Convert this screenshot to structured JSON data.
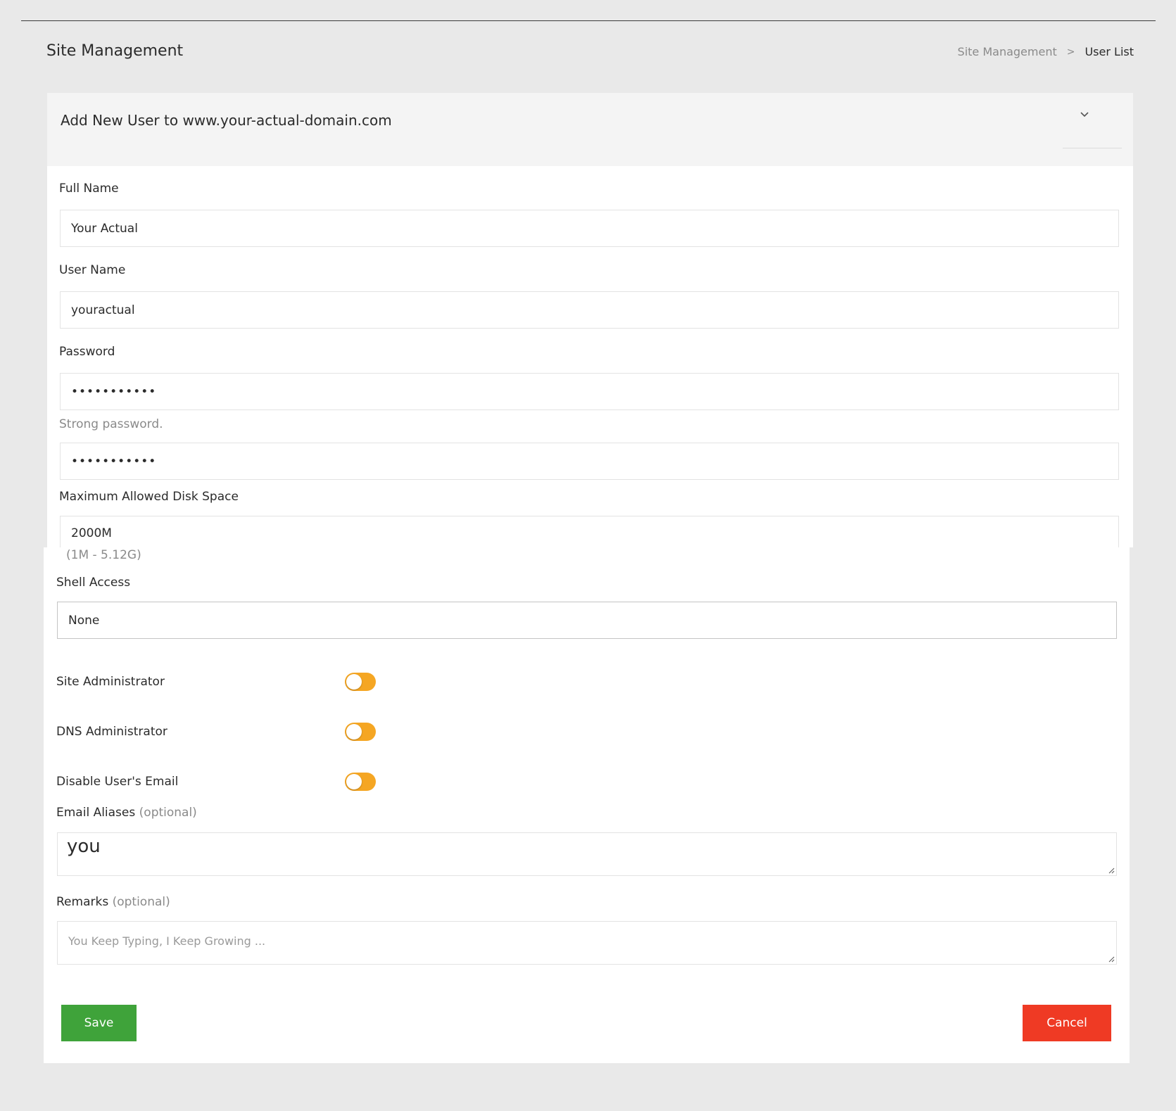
{
  "header": {
    "page_title": "Site Management",
    "breadcrumb": {
      "parent": "Site Management",
      "separator": ">",
      "current": "User List"
    }
  },
  "card": {
    "title": "Add New User to www.your-actual-domain.com",
    "collapse_icon": "chevron-down-icon"
  },
  "form": {
    "full_name": {
      "label": "Full Name",
      "value": "Your Actual"
    },
    "user_name": {
      "label": "User Name",
      "value": "youractual"
    },
    "password": {
      "label": "Password",
      "value": "•••••••••••",
      "strength_text": "Strong password.",
      "confirm_value": "•••••••••••"
    },
    "disk_space": {
      "label": "Maximum Allowed Disk Space",
      "value": "2000M",
      "range_hint": "(1M - 5.12G)"
    },
    "shell_access": {
      "label": "Shell Access",
      "selected": "None"
    },
    "toggles": [
      {
        "label": "Site Administrator",
        "on": false
      },
      {
        "label": "DNS Administrator",
        "on": false
      },
      {
        "label": "Disable User's Email",
        "on": false
      }
    ],
    "email_aliases": {
      "label": "Email Aliases",
      "optional": "(optional)",
      "value": "you"
    },
    "remarks": {
      "label": "Remarks",
      "optional": "(optional)",
      "placeholder": "You Keep Typing, I Keep Growing ..."
    }
  },
  "actions": {
    "save_label": "Save",
    "cancel_label": "Cancel"
  },
  "colors": {
    "background": "#e9e9e9",
    "toggle": "#f5a623",
    "save": "#3fa33a",
    "cancel": "#ef3a24"
  }
}
